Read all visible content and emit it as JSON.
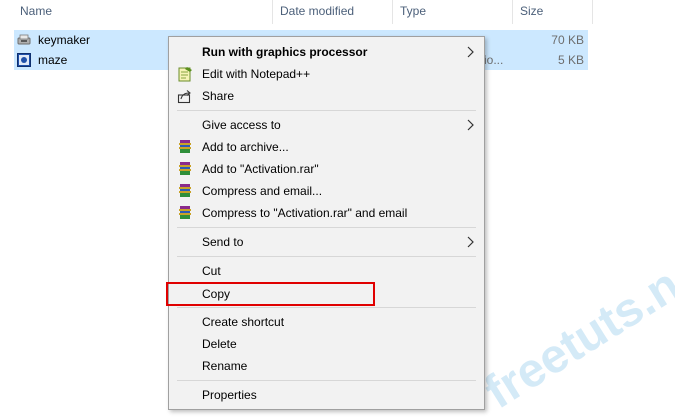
{
  "columns": {
    "name": "Name",
    "date_modified": "Date modified",
    "type": "Type",
    "size": "Size"
  },
  "files": [
    {
      "name": "keymaker",
      "date": "",
      "type": "",
      "size": "70 KB",
      "icon": "app-icon"
    },
    {
      "name": "maze",
      "date": "",
      "type": "io...",
      "size": "5 KB",
      "icon": "media-icon"
    }
  ],
  "context_menu": {
    "run_gpu": "Run with graphics processor",
    "edit_notepad": "Edit with Notepad++",
    "share": "Share",
    "give_access": "Give access to",
    "add_archive": "Add to archive...",
    "add_activation": "Add to \"Activation.rar\"",
    "compress_email": "Compress and email...",
    "compress_activation_email": "Compress to \"Activation.rar\" and email",
    "send_to": "Send to",
    "cut": "Cut",
    "copy": "Copy",
    "create_shortcut": "Create shortcut",
    "delete": "Delete",
    "rename": "Rename",
    "properties": "Properties"
  },
  "watermark": {
    "text": "freetuts.net"
  },
  "colors": {
    "selection": "#cce8ff",
    "highlight_box": "#e00000",
    "menu_bg": "#f2f2f2"
  }
}
